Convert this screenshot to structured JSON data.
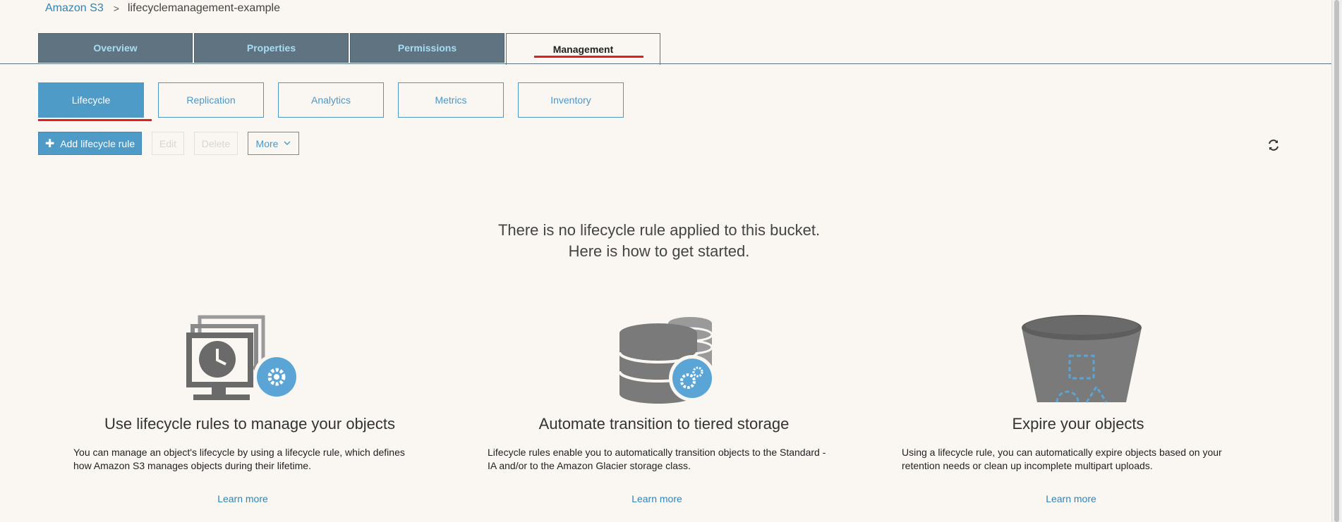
{
  "breadcrumb": {
    "root": "Amazon S3",
    "separator": ">",
    "current": "lifecyclemanagement-example"
  },
  "tabs": [
    {
      "label": "Overview",
      "active": false
    },
    {
      "label": "Properties",
      "active": false
    },
    {
      "label": "Permissions",
      "active": false
    },
    {
      "label": "Management",
      "active": true
    }
  ],
  "subtabs": [
    {
      "label": "Lifecycle",
      "active": true
    },
    {
      "label": "Replication",
      "active": false
    },
    {
      "label": "Analytics",
      "active": false
    },
    {
      "label": "Metrics",
      "active": false
    },
    {
      "label": "Inventory",
      "active": false
    }
  ],
  "toolbar": {
    "add_label": "Add lifecycle rule",
    "edit_label": "Edit",
    "delete_label": "Delete",
    "more_label": "More",
    "refresh_icon": "refresh-icon"
  },
  "empty_state": {
    "line1": "There is no lifecycle rule applied to this bucket.",
    "line2": "Here is how to get started."
  },
  "features": [
    {
      "title": "Use lifecycle rules to manage your objects",
      "description": "You can manage an object's lifecycle by using a lifecycle rule, which defines how Amazon S3 manages objects during their lifetime.",
      "link": "Learn more",
      "icon": "monitor-clock-gear-icon"
    },
    {
      "title": "Automate transition to tiered storage",
      "description": "Lifecycle rules enable you to automatically transition objects to the Standard - IA and/or to the Amazon Glacier storage class.",
      "link": "Learn more",
      "icon": "database-gear-icon"
    },
    {
      "title": "Expire your objects",
      "description": "Using a lifecycle rule, you can automatically expire objects based on your retention needs or clean up incomplete multipart uploads.",
      "link": "Learn more",
      "icon": "bucket-icon"
    }
  ],
  "colors": {
    "accent": "#4f9bc8",
    "tab_bg": "#5f7480",
    "highlight": "#e02020",
    "background": "#faf7f2"
  }
}
